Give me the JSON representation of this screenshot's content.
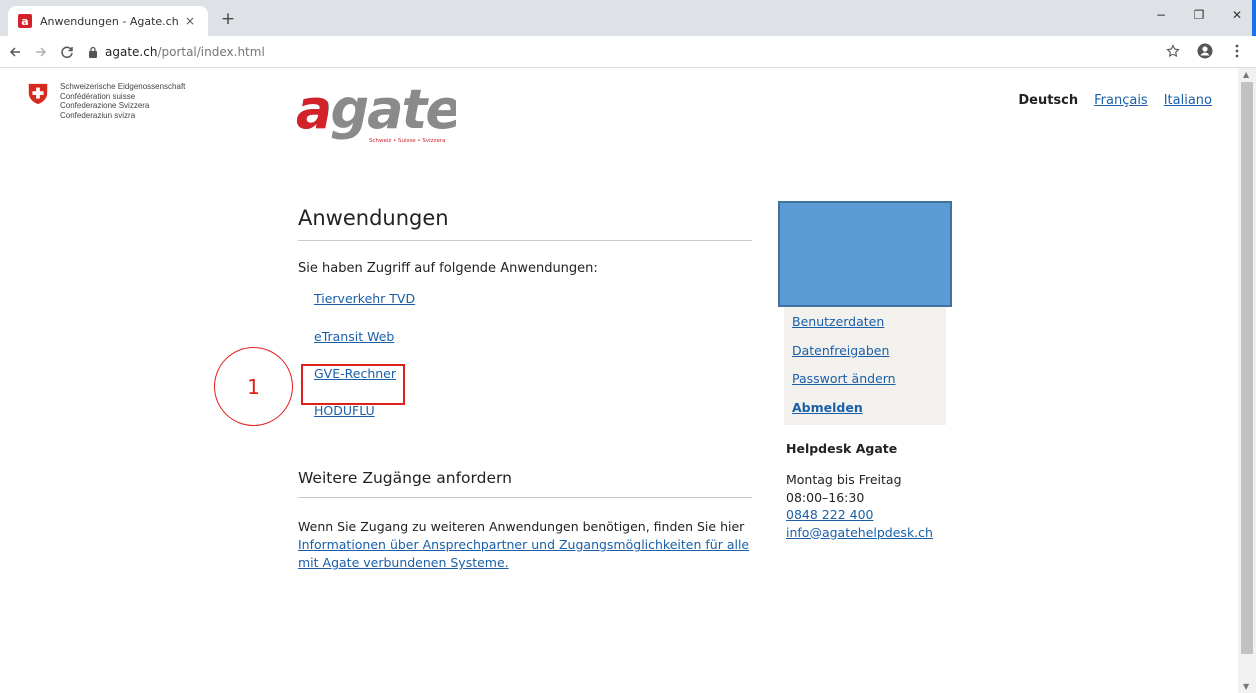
{
  "browser": {
    "tab_title": "Anwendungen - Agate.ch",
    "tab_close": "×",
    "new_tab": "+",
    "url_host": "agate.ch",
    "url_path": "/portal/index.html",
    "minimize": "−",
    "restore": "❐",
    "close": "✕"
  },
  "header": {
    "confederation_lines": [
      "Schweizerische Eidgenossenschaft",
      "Confédération suisse",
      "Confederazione Svizzera",
      "Confederaziun svizra"
    ],
    "logo_text": "agate",
    "logo_tagline": "Schweiz • Suisse • Svizzera",
    "languages": {
      "active": "Deutsch",
      "fr": "Français",
      "it": "Italiano"
    }
  },
  "main": {
    "title": "Anwendungen",
    "intro": "Sie haben Zugriff auf folgende Anwendungen:",
    "apps": [
      "Tierverkehr TVD",
      "eTransit Web",
      "GVE-Rechner",
      "HODUFLU"
    ],
    "more_title": "Weitere Zugänge anfordern",
    "more_text": "Wenn Sie Zugang zu weiteren Anwendungen benötigen, finden Sie hier ",
    "more_link": "Informationen über Ansprechpartner und Zugangsmöglichkeiten für alle mit Agate verbundenen Systeme."
  },
  "sidebar": {
    "links": [
      "Benutzerdaten",
      "Datenfreigaben",
      "Passwort ändern"
    ],
    "logout": "Abmelden",
    "help_title": "Helpdesk Agate",
    "help_days": "Montag bis Freitag",
    "help_hours": "08:00–16:30",
    "help_phone": "0848 222 400",
    "help_email": "info@agatehelpdesk.ch"
  },
  "annotation": {
    "number": "1"
  },
  "colors": {
    "link": "#1a5fa8",
    "annotation": "#e0201a",
    "redaction": "#5b9bd5",
    "agate_red": "#d2232a",
    "agate_grey": "#8a8a8a"
  }
}
